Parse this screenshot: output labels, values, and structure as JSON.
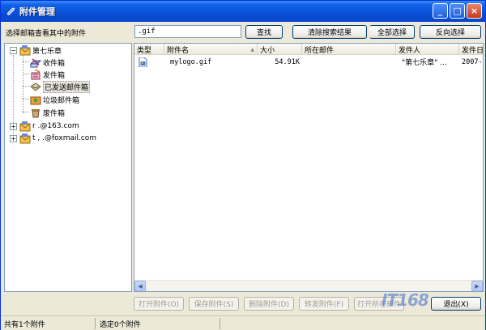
{
  "window": {
    "title": "附件管理",
    "controls": {
      "minimize": "_",
      "maximize": "□",
      "close": "×"
    }
  },
  "top": {
    "left_label": "选择邮箱查看其中的附件",
    "search_value": ".gif",
    "buttons": {
      "find": "查找",
      "clear": "清除搜索结果",
      "select_all": "全部选择",
      "invert": "反向选择"
    }
  },
  "tree": {
    "nodes": [
      {
        "label": "第七乐章",
        "expander": "−",
        "icon": "mailbox-icon"
      },
      {
        "label": "收件箱",
        "icon": "inbox-icon"
      },
      {
        "label": "发件箱",
        "icon": "outbox-icon"
      },
      {
        "label": "已发送邮件箱",
        "icon": "sent-icon"
      },
      {
        "label": "垃圾邮件箱",
        "icon": "junk-icon"
      },
      {
        "label": "废件箱",
        "icon": "trash-icon"
      },
      {
        "label": "r        .@163.com",
        "expander": "+",
        "icon": "mailbox-icon"
      },
      {
        "label": "t  ,        .@foxmail.com",
        "expander": "+",
        "icon": "mailbox-icon"
      }
    ]
  },
  "list": {
    "columns": [
      "类型",
      "附件名",
      "大小",
      "所在邮件",
      "发件人",
      "发件日"
    ],
    "sort_arrow": "▲",
    "rows": [
      {
        "type_icon": "image-file-icon",
        "name": "mylogo.gif",
        "size": "54.91K",
        "mail": "",
        "sender": "\"第七乐章\" ...",
        "date": "2007-"
      }
    ],
    "scroll": {
      "left": "◀",
      "right": "▶"
    }
  },
  "bottom_buttons": [
    {
      "label": "打开附件(O)",
      "enabled": false
    },
    {
      "label": "保存附件(S)",
      "enabled": false
    },
    {
      "label": "删除附件(D)",
      "enabled": false
    },
    {
      "label": "转发附件(F)",
      "enabled": false
    },
    {
      "label": "打开所在邮件",
      "enabled": false
    },
    {
      "label": "退出(X)",
      "enabled": true
    }
  ],
  "status": {
    "total": "共有1个附件",
    "selected": "选定0个附件"
  },
  "watermark": "IT168",
  "colors": {
    "titlebar": "#0a4fd8",
    "window_bg": "#ece9d8",
    "border": "#7f9db9"
  }
}
